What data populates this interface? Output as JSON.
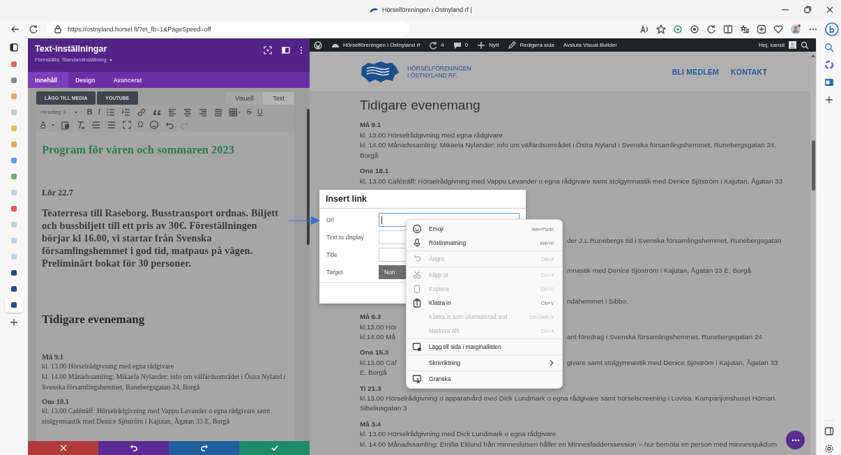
{
  "browser": {
    "title": "Hörselföreningen i Östnyland rf |",
    "url": "https://ostnyland.horsel.fi/?et_fb=1&PageSpeed=off"
  },
  "settings_panel": {
    "title": "Text-inställningar",
    "preset": "Förinställa: Standardinställning",
    "tabs": [
      {
        "label": "Innehåll",
        "selected": true
      },
      {
        "label": "Design",
        "selected": false
      },
      {
        "label": "Avancerat",
        "selected": false
      }
    ],
    "media_buttons": [
      "LÄGG TILL MEDIA",
      "YOUTUBE"
    ],
    "editor_tabs": [
      {
        "label": "Visuell",
        "selected": true
      },
      {
        "label": "Text",
        "selected": false
      }
    ],
    "format_select": "Heading 3",
    "toolbar_glyphs": {
      "bold": "B",
      "italic": "I",
      "strike": "S",
      "underline": "U",
      "text_color": "A",
      "special_chars": "Ω"
    },
    "editor_content": [
      {
        "kind": "heading",
        "text": "Program för våren och sommaren 2023"
      },
      {
        "kind": "date",
        "text": "Lör 22.7"
      },
      {
        "kind": "lead",
        "text": "Teaterresa till Raseborg. Busstransport ordnas. Biljett och bussbiljett till ett pris av 30€. Föreställningen börjar kl 16.00, vi startar från Svenska församlingshemmet i god tid, matpaus på vägen. Preliminärt bokat för 30 personer."
      },
      {
        "kind": "subheading",
        "text": "Tidigare evenemang"
      },
      {
        "kind": "small_date",
        "text": "Må 9.1"
      },
      {
        "kind": "line",
        "text": "kl. 13.00 Hörselrådgivning med egna rådgivare"
      },
      {
        "kind": "line",
        "text": "kl. 14.00 Månadssamling: Mikaela Nylander: info om välfärdsområdet i Östra Nyland i Svenska församlingshemmet, Runebergsgatan 24, Borgå"
      },
      {
        "kind": "small_date",
        "text": "Ons 18.1"
      },
      {
        "kind": "line",
        "text": "kl. 13.00 Caféträff: Hörselrådgivning med Vappu Levander o egna rådgivare samt stolgymnastik med Denice Sjöström i Kajutan, Ågatan 33 E, Borgå"
      }
    ],
    "action_buttons": [
      {
        "kind": "discard"
      },
      {
        "kind": "undo"
      },
      {
        "kind": "redo"
      },
      {
        "kind": "save"
      }
    ]
  },
  "admin_bar": {
    "site": "Hörselföreningen i Östnyland rf",
    "updates": "4",
    "comments": "0",
    "new": "Nytt",
    "edit": "Redigera sida",
    "exit": "Avsluta Visual Builder",
    "greeting": "Hej, kansli"
  },
  "site": {
    "logo_lines": [
      "HÖRSELFÖRENINGEN",
      "I ÖSTNYLAND RF."
    ],
    "nav": [
      "BLI MEDLEM",
      "KONTAKT"
    ],
    "heading": "Tidigare evenemang",
    "events": [
      {
        "date": "Må 9.1",
        "lines": [
          {
            "text": "kl. 13.00 Hörselrådgivning med egna rådgivare"
          },
          {
            "text": "kl. 14.00 Månadssamling: Mikaela Nylander: info om välfärdsområdet i Östra Nyland i Svenska församlingshemmet, Runebergsgatan 24, Borgå"
          }
        ]
      },
      {
        "date": "Ons 18.1",
        "lines": [
          {
            "text": "kl. 13.00 Caféträff: Hörselrådgivning med Vappu Levander o egna rådgivare samt stolgymnastik med Denice Sjöström i Kajutan, Ågatan 33"
          }
        ]
      },
      {
        "lines": [
          {
            "right": "der J.L.Runebergs tid i Svenska församlingshemmet, Runebergsgatan"
          }
        ]
      },
      {
        "lines": [
          {
            "right": "mnastik med Denice Sjöström i Kajutan, Ågatan 33 E, Borgå"
          }
        ]
      },
      {
        "lines": [
          {
            "right": "ndahemmet i Sibbo."
          }
        ]
      },
      {
        "date": "Må 6.3",
        "lines": [
          {
            "left": "kl.13.00 Hör"
          },
          {
            "left": "kl.14.00 Må",
            "right": "ant föredrag i Svenska församlingshemmet, Runebergsgatan 24"
          }
        ]
      },
      {
        "date": "Ons 15.3",
        "lines": [
          {
            "left": "kl.13.00 Caf",
            "right": "givare samt stolgymnastik med Denice Sjöström i Kajutan, Ågatan 33"
          },
          {
            "left": "E. Borgå"
          }
        ]
      },
      {
        "date": "Ti 21.3",
        "lines": [
          {
            "text": "kl.13.00 Hörselrådgivning o apparatvård med Dick Lundmark o egna rådgivare samt hörselscreening i Lovisa. Kompanjonshuset Hörnan. Sibeliusgatan 3"
          }
        ]
      },
      {
        "date": "Må 3.4",
        "lines": [
          {
            "text": "kl. 13.00 Hörselrådgivning med Dick Lundmark o egna rådgivare"
          },
          {
            "text": "kl. 14.00 Månadssamling: Emilia Eklund från minneslotsen håller en Minnesfadderssession = hur bemöta en person med minnessjukdom"
          }
        ]
      }
    ]
  },
  "dialog": {
    "title": "Insert link",
    "fields": [
      {
        "label": "Url",
        "focused": true
      },
      {
        "label": "Text to display",
        "focused": false
      },
      {
        "label": "Title",
        "focused": false
      }
    ],
    "target": {
      "label": "Target",
      "value": "Non"
    }
  },
  "context_menu": [
    {
      "kind": "item",
      "label": "Emoji",
      "shortcut": "Win+Punkt",
      "disabled": false
    },
    {
      "kind": "item",
      "label": "Röstinmatning",
      "shortcut": "Win+H",
      "disabled": false
    },
    {
      "kind": "separator"
    },
    {
      "kind": "item",
      "label": "Ångra",
      "shortcut": "Ctrl+Z",
      "disabled": true
    },
    {
      "kind": "separator"
    },
    {
      "kind": "item",
      "label": "Klipp ut",
      "shortcut": "Ctrl+X",
      "disabled": true
    },
    {
      "kind": "item",
      "label": "Kopiera",
      "shortcut": "Ctrl+C",
      "disabled": true
    },
    {
      "kind": "item",
      "label": "Klistra in",
      "shortcut": "Ctrl+V",
      "disabled": false
    },
    {
      "kind": "item",
      "label": "Klistra in som oformaterad text",
      "shortcut": "Ctrl+Skift+V",
      "disabled": true
    },
    {
      "kind": "item",
      "label": "Markera allt",
      "shortcut": "Ctrl+A",
      "disabled": true
    },
    {
      "kind": "separator"
    },
    {
      "kind": "item",
      "label": "Lägg till sida i marginallisten",
      "disabled": false
    },
    {
      "kind": "separator"
    },
    {
      "kind": "submenu",
      "label": "Skrivriktning",
      "disabled": false
    },
    {
      "kind": "separator"
    },
    {
      "kind": "item",
      "label": "Granska",
      "disabled": false
    }
  ]
}
